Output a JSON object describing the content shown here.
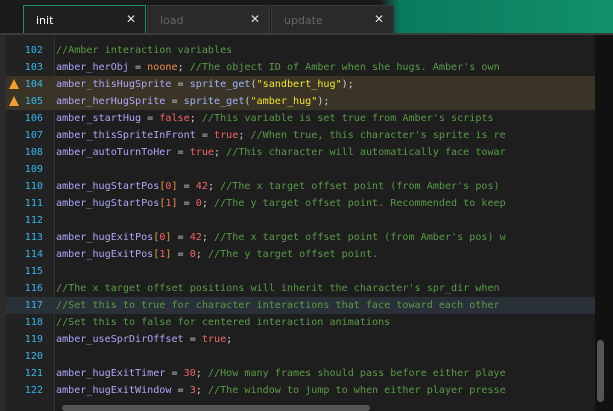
{
  "tabs": [
    {
      "label": "init",
      "active": true
    },
    {
      "label": "load",
      "active": false
    },
    {
      "label": "update",
      "active": false
    }
  ],
  "close_glyph": "✕",
  "lines": [
    {
      "n": "102",
      "t": [
        [
          "cm",
          "//Amber interaction variables"
        ]
      ]
    },
    {
      "n": "103",
      "t": [
        [
          "id",
          "amber_herObj"
        ],
        [
          "op",
          " = "
        ],
        [
          "kw",
          "noone"
        ],
        [
          "op",
          "; "
        ],
        [
          "cm",
          "//The object ID of Amber when she hugs. Amber's own"
        ]
      ]
    },
    {
      "n": "104",
      "warn": true,
      "t": [
        [
          "id",
          "amber_thisHugSprite"
        ],
        [
          "op",
          " = "
        ],
        [
          "fn",
          "sprite_get"
        ],
        [
          "op",
          "("
        ],
        [
          "str",
          "\"sandbert_hug\""
        ],
        [
          "op",
          ");"
        ]
      ]
    },
    {
      "n": "105",
      "warn": true,
      "t": [
        [
          "id",
          "amber_herHugSprite"
        ],
        [
          "op",
          " = "
        ],
        [
          "fn",
          "sprite_get"
        ],
        [
          "op",
          "("
        ],
        [
          "str",
          "\"amber_hug\""
        ],
        [
          "op",
          ");"
        ]
      ]
    },
    {
      "n": "106",
      "t": [
        [
          "id",
          "amber_startHug"
        ],
        [
          "op",
          " = "
        ],
        [
          "num",
          "false"
        ],
        [
          "op",
          "; "
        ],
        [
          "cm",
          "//This variable is set true from Amber's scripts"
        ]
      ]
    },
    {
      "n": "107",
      "t": [
        [
          "id",
          "amber_thisSpriteInFront"
        ],
        [
          "op",
          " = "
        ],
        [
          "num",
          "true"
        ],
        [
          "op",
          "; "
        ],
        [
          "cm",
          "//When true, this character's sprite is re"
        ]
      ]
    },
    {
      "n": "108",
      "t": [
        [
          "id",
          "amber_autoTurnToHer"
        ],
        [
          "op",
          " = "
        ],
        [
          "num",
          "true"
        ],
        [
          "op",
          "; "
        ],
        [
          "cm",
          "//This character will automatically face towar"
        ]
      ]
    },
    {
      "n": "109",
      "t": []
    },
    {
      "n": "110",
      "t": [
        [
          "id",
          "amber_hugStartPos"
        ],
        [
          "br",
          "["
        ],
        [
          "num",
          "0"
        ],
        [
          "br",
          "]"
        ],
        [
          "op",
          " = "
        ],
        [
          "num",
          "42"
        ],
        [
          "op",
          "; "
        ],
        [
          "cm",
          "//The x target offset point (from Amber's pos)"
        ]
      ]
    },
    {
      "n": "111",
      "t": [
        [
          "id",
          "amber_hugStartPos"
        ],
        [
          "br",
          "["
        ],
        [
          "num",
          "1"
        ],
        [
          "br",
          "]"
        ],
        [
          "op",
          " = "
        ],
        [
          "num",
          "0"
        ],
        [
          "op",
          "; "
        ],
        [
          "cm",
          "//The y target offset point. Recommended to keep"
        ]
      ]
    },
    {
      "n": "112",
      "t": []
    },
    {
      "n": "113",
      "t": [
        [
          "id",
          "amber_hugExitPos"
        ],
        [
          "br",
          "["
        ],
        [
          "num",
          "0"
        ],
        [
          "br",
          "]"
        ],
        [
          "op",
          " = "
        ],
        [
          "num",
          "42"
        ],
        [
          "op",
          "; "
        ],
        [
          "cm",
          "//The x target offset point (from Amber's pos) w"
        ]
      ]
    },
    {
      "n": "114",
      "t": [
        [
          "id",
          "amber_hugExitPos"
        ],
        [
          "br",
          "["
        ],
        [
          "num",
          "1"
        ],
        [
          "br",
          "]"
        ],
        [
          "op",
          " = "
        ],
        [
          "num",
          "0"
        ],
        [
          "op",
          "; "
        ],
        [
          "cm",
          "//The y target offset point."
        ]
      ]
    },
    {
      "n": "115",
      "t": []
    },
    {
      "n": "116",
      "t": [
        [
          "cm",
          "//The x target offset positions will inherit the character's spr_dir when"
        ]
      ]
    },
    {
      "n": "117",
      "cur": true,
      "t": [
        [
          "cm",
          "//Set this to true for character interactions that face toward each other"
        ]
      ]
    },
    {
      "n": "118",
      "t": [
        [
          "cm",
          "//Set this to false for centered interaction animations"
        ]
      ]
    },
    {
      "n": "119",
      "t": [
        [
          "id",
          "amber_useSprDirOffset"
        ],
        [
          "op",
          " = "
        ],
        [
          "num",
          "true"
        ],
        [
          "op",
          ";"
        ]
      ]
    },
    {
      "n": "120",
      "t": []
    },
    {
      "n": "121",
      "t": [
        [
          "id",
          "amber_hugExitTimer"
        ],
        [
          "op",
          " = "
        ],
        [
          "num",
          "30"
        ],
        [
          "op",
          "; "
        ],
        [
          "cm",
          "//How many frames should pass before either playe"
        ]
      ]
    },
    {
      "n": "122",
      "t": [
        [
          "id",
          "amber_hugExitWindow"
        ],
        [
          "op",
          " = "
        ],
        [
          "num",
          "3"
        ],
        [
          "op",
          "; "
        ],
        [
          "cm",
          "//The window to jump to when either player presse"
        ]
      ]
    }
  ]
}
